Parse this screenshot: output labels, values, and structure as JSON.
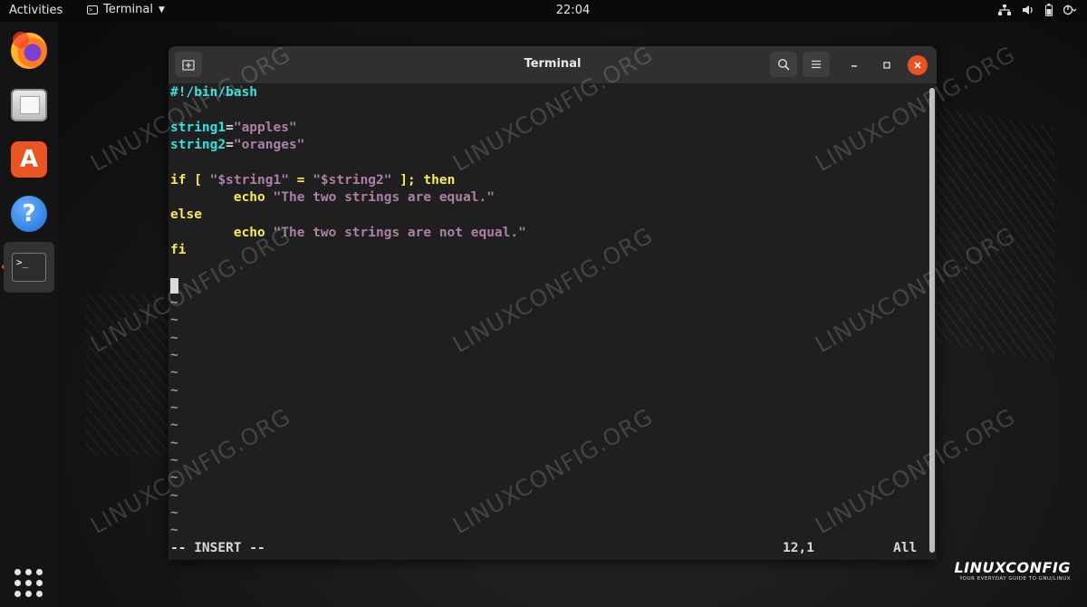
{
  "topbar": {
    "activities": "Activities",
    "app_menu": "Terminal",
    "clock": "22:04"
  },
  "window": {
    "title": "Terminal"
  },
  "editor": {
    "line1": "#!/bin/bash",
    "line3_var": "string1",
    "line3_eq": "=",
    "line3_val": "\"apples\"",
    "line4_var": "string2",
    "line4_eq": "=",
    "line4_val": "\"oranges\"",
    "if_kw": "if",
    "if_open": " [ ",
    "if_left": "\"$string1\"",
    "if_eq": " = ",
    "if_right": "\"$string2\"",
    "if_close": " ]; ",
    "then_kw": "then",
    "echo_kw": "echo",
    "echo1_str": "\"The two strings are equal.\"",
    "else_kw": "else",
    "echo2_str": "\"The two strings are not equal.\"",
    "fi_kw": "fi",
    "tilde": "~",
    "mode": "-- INSERT --",
    "position": "12,1",
    "scroll": "All"
  },
  "watermark": {
    "text": "LINUXCONFIG.ORG",
    "logo_main": "LINUXCONFIG",
    "logo_tagline": "YOUR EVERYDAY GUIDE TO GNU/LINUX"
  },
  "colors": {
    "accent": "#e95420",
    "cyan": "#34e2e2",
    "magenta": "#ad7fa8",
    "yellow": "#fce94f",
    "tilde_blue": "#729fcf"
  },
  "icons": {
    "dock": [
      "firefox-icon",
      "files-icon",
      "app-store-icon",
      "help-icon",
      "terminal-icon"
    ],
    "headerbar": [
      "new-tab-icon",
      "search-icon",
      "hamburger-menu-icon",
      "minimize-icon",
      "maximize-icon",
      "close-icon"
    ],
    "tray": [
      "network-icon",
      "volume-icon",
      "battery-icon",
      "power-menu-icon"
    ]
  }
}
